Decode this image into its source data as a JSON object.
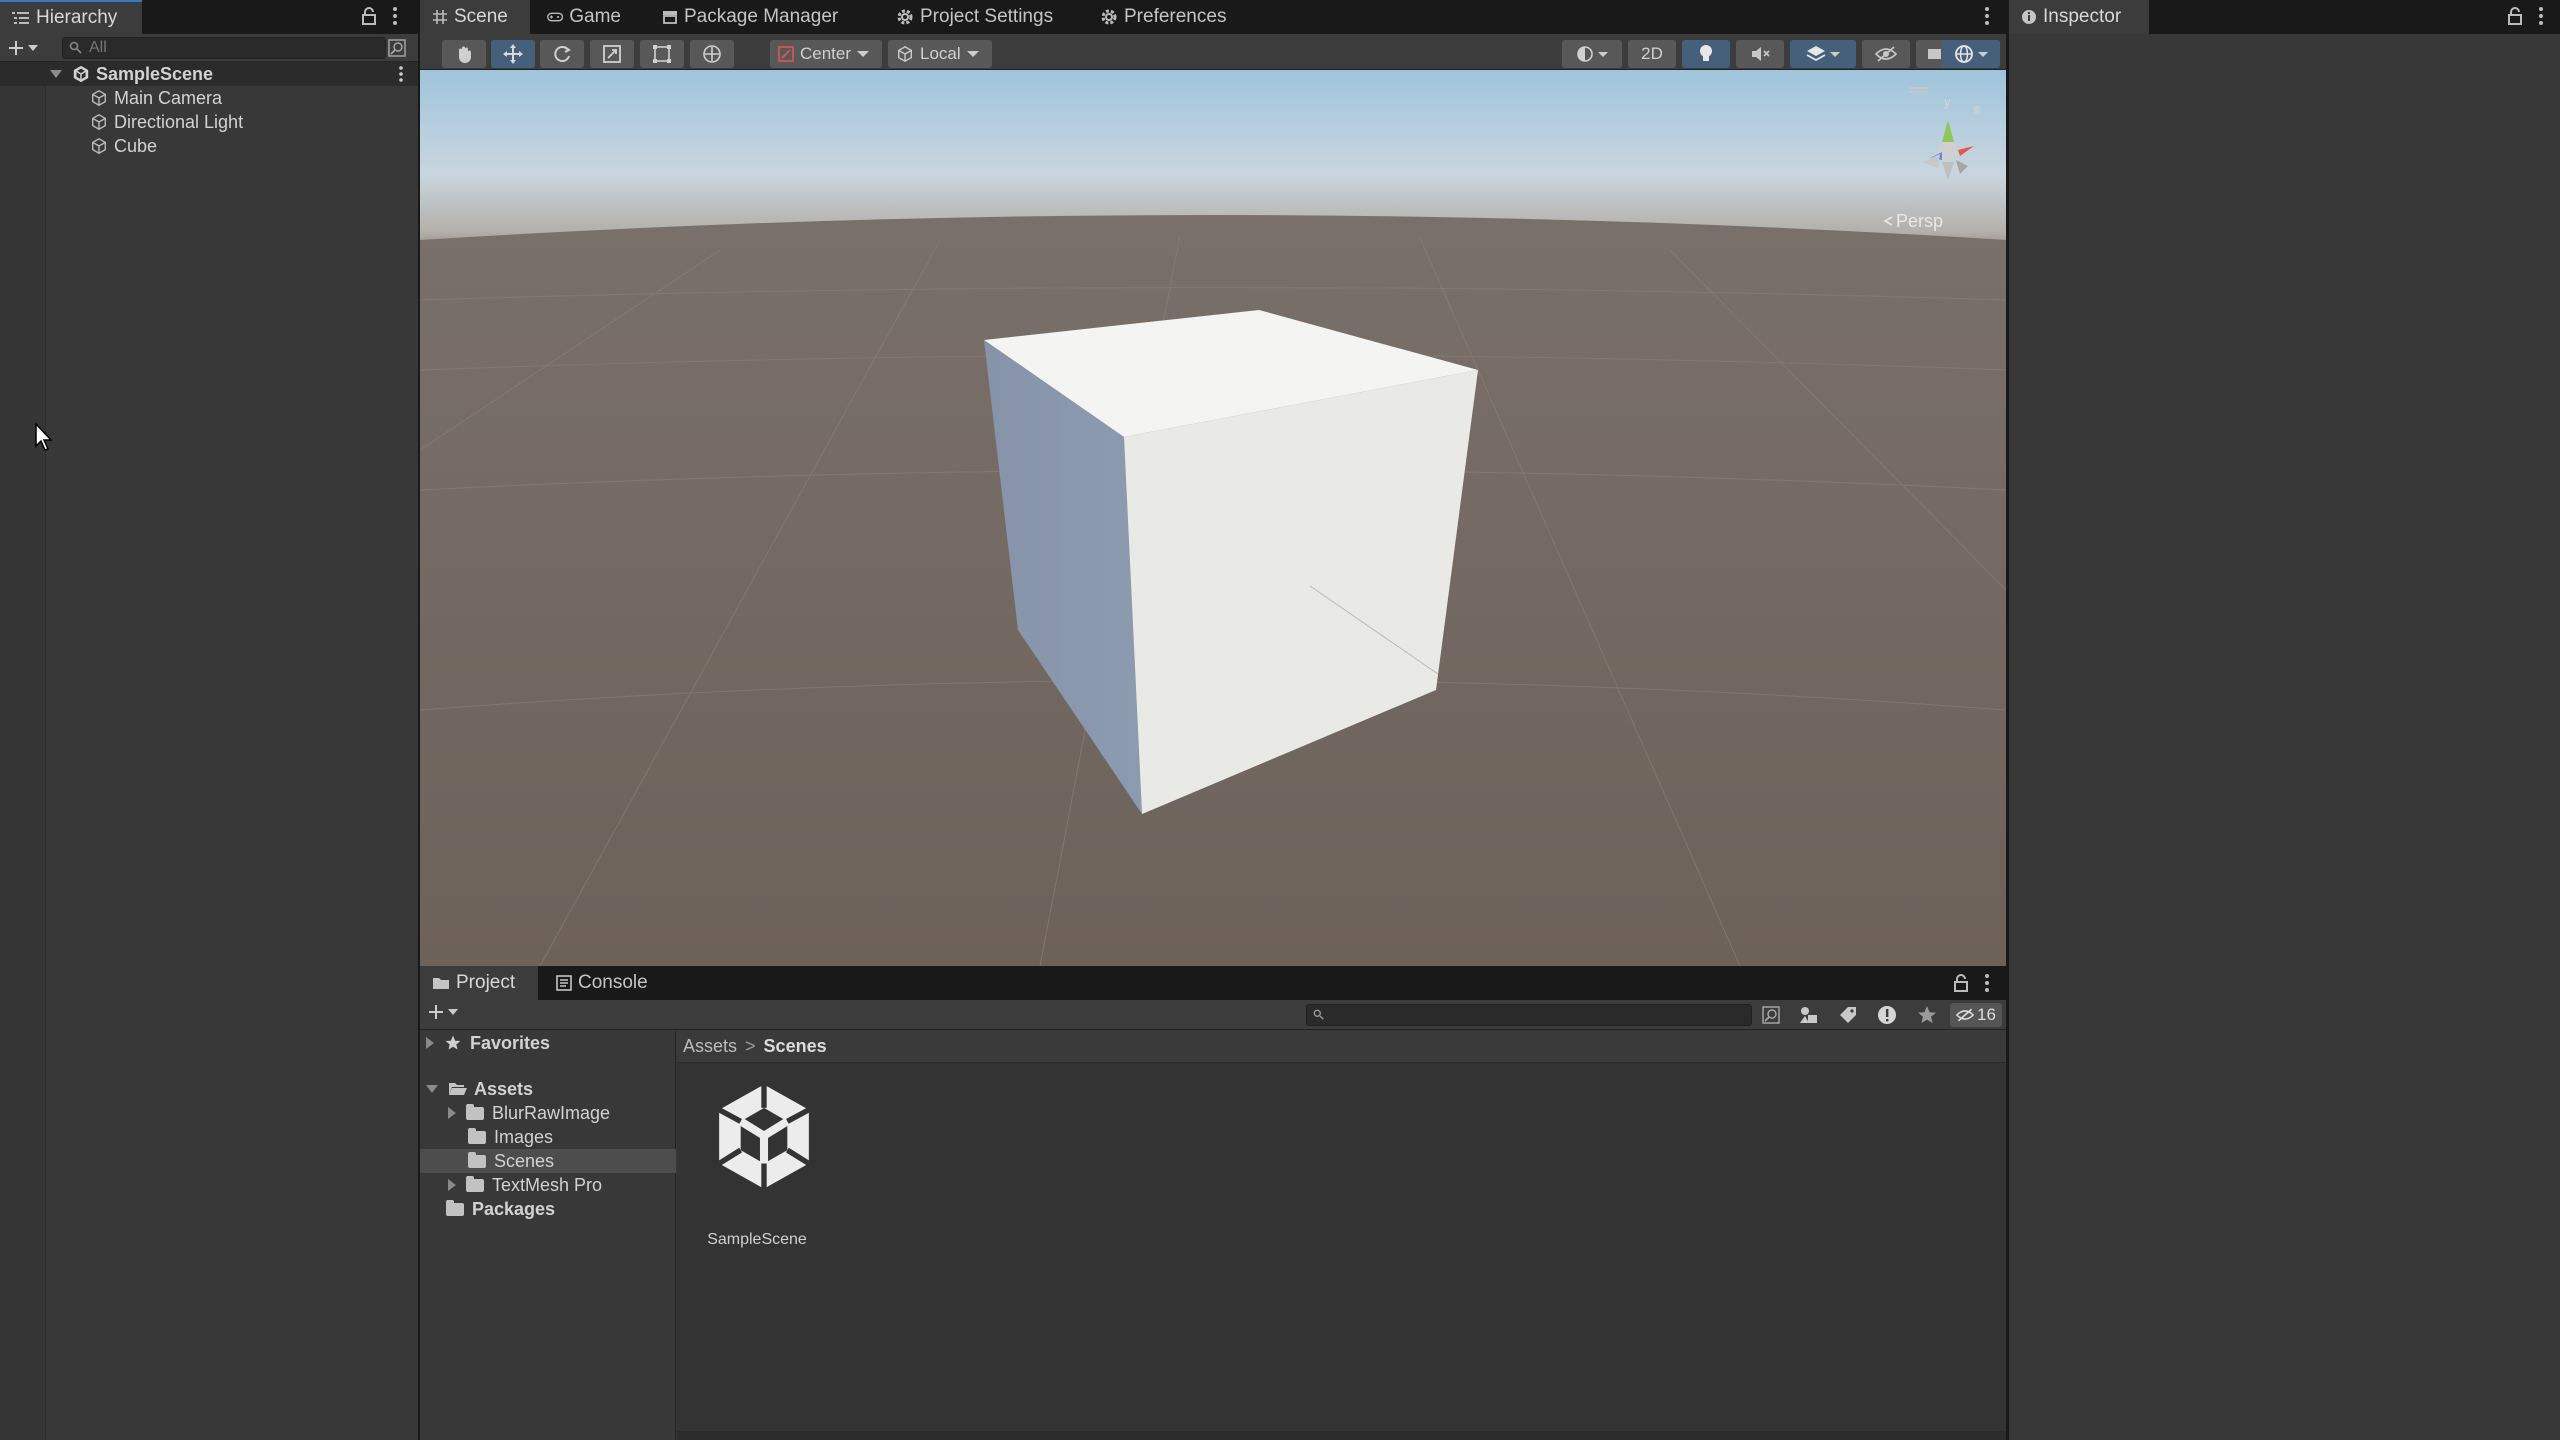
{
  "hierarchy": {
    "tab_label": "Hierarchy",
    "search_placeholder": "All",
    "scene_name": "SampleScene",
    "items": [
      {
        "label": "Main Camera"
      },
      {
        "label": "Directional Light"
      },
      {
        "label": "Cube"
      }
    ]
  },
  "top_tabs": {
    "scene": "Scene",
    "game": "Game",
    "package_manager": "Package Manager",
    "project_settings": "Project Settings",
    "preferences": "Preferences"
  },
  "scene_toolbar": {
    "pivot_mode": "Center",
    "pivot_rotation": "Local",
    "mode_2d": "2D"
  },
  "gizmo": {
    "projection": "Persp",
    "axis_y": "y"
  },
  "inspector": {
    "tab_label": "Inspector"
  },
  "bottom_tabs": {
    "project": "Project",
    "console": "Console"
  },
  "project": {
    "hidden_count": "16",
    "tree": {
      "favorites": "Favorites",
      "assets": "Assets",
      "assets_children": [
        "BlurRawImage",
        "Images",
        "Scenes",
        "TextMesh Pro"
      ],
      "packages": "Packages"
    },
    "breadcrumb": {
      "root": "Assets",
      "separator": ">",
      "current": "Scenes"
    },
    "asset_items": [
      {
        "label": "SampleScene",
        "icon": "unity-scene-icon"
      }
    ]
  },
  "colors": {
    "accent_blue": "#3a79bb",
    "selection": "#4d4d4d",
    "panel": "#383838",
    "tabbar": "#191919"
  }
}
